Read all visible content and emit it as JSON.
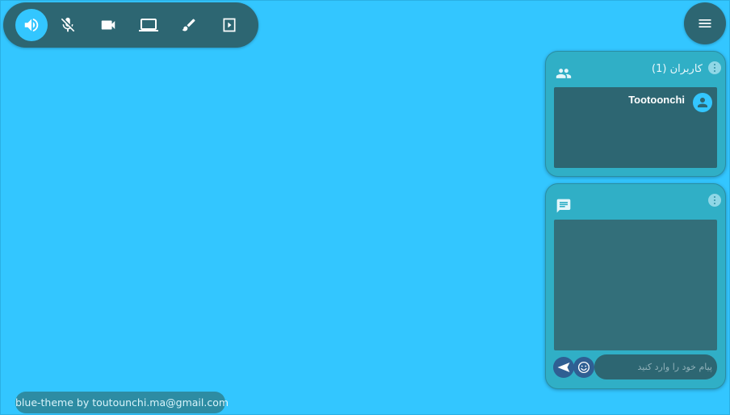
{
  "toolbar": {
    "buttons": [
      {
        "icon": "speaker-icon",
        "active": true
      },
      {
        "icon": "mic-off-icon",
        "active": false
      },
      {
        "icon": "video-camera-icon",
        "active": false
      },
      {
        "icon": "laptop-screen-share-icon",
        "active": false
      },
      {
        "icon": "brush-whiteboard-icon",
        "active": false
      },
      {
        "icon": "play-presentation-icon",
        "active": false
      }
    ]
  },
  "menu": {
    "icon": "hamburger-menu-icon"
  },
  "users_panel": {
    "title": "کاربران (1)",
    "icon": "people-icon",
    "users": [
      {
        "name": "Tootoonchi",
        "icon": "person-avatar-icon"
      }
    ]
  },
  "chat_panel": {
    "icon": "chat-message-icon",
    "input_placeholder": "پیام خود را وارد کنید",
    "input_value": "",
    "emoji_icon": "smiley-icon",
    "send_icon": "send-icon"
  },
  "footer": {
    "credit": "blue-theme by toutounchi.ma@gmail.com"
  },
  "colors": {
    "background": "#33c6ff",
    "dark_teal": "#2d6672",
    "panel": "#30afc6",
    "accent_blue": "#2f5f93"
  }
}
